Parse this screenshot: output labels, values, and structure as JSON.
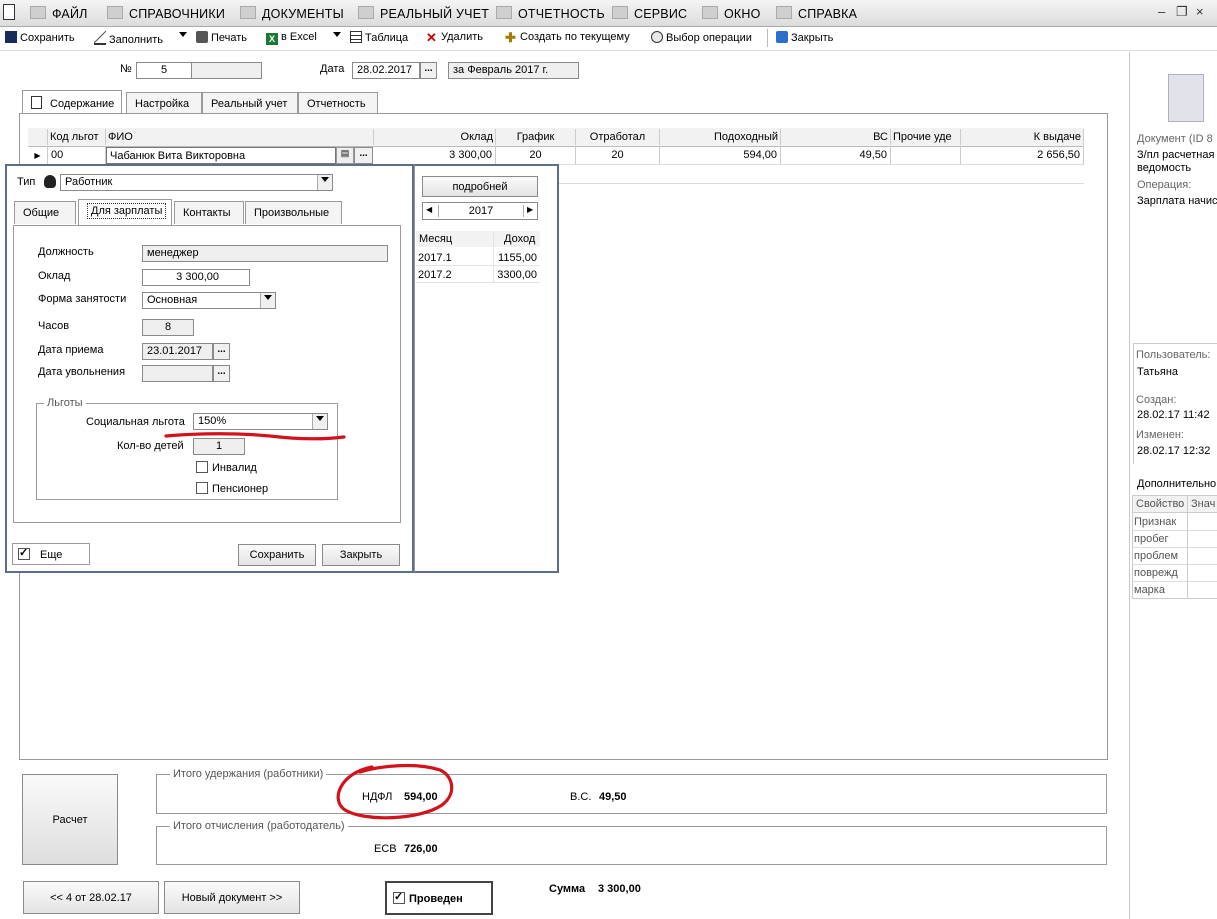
{
  "menu": {
    "items": [
      "ФАЙЛ",
      "СПРАВОЧНИКИ",
      "ДОКУМЕНТЫ",
      "РЕАЛЬНЫЙ УЧЕТ",
      "ОТЧЕТНОСТЬ",
      "СЕРВИС",
      "ОКНО",
      "СПРАВКА"
    ],
    "window_controls": [
      "–",
      "❐",
      "×"
    ]
  },
  "toolbar": {
    "save": "Сохранить",
    "fill": "Заполнить",
    "print": "Печать",
    "excel": "в Excel",
    "table": "Таблица",
    "delete": "Удалить",
    "create_from_current": "Создать по текущему",
    "choose_operation": "Выбор операции",
    "close": "Закрыть"
  },
  "header": {
    "number_label": "№",
    "number_value": "5",
    "date_label": "Дата",
    "date_value": "28.02.2017",
    "period": "за Февраль 2017 г."
  },
  "main_tabs": [
    "Содержание",
    "Настройка",
    "Реальный учет",
    "Отчетность"
  ],
  "grid": {
    "columns": [
      "Код льгот",
      "ФИО",
      "Оклад",
      "График",
      "Отработал",
      "Подоходный",
      "ВС",
      "Прочие уде",
      "К выдаче"
    ],
    "rows": [
      {
        "code": "00",
        "name": "Чабанюк Вита Викторовна",
        "salary": "3 300,00",
        "schedule": "20",
        "worked": "20",
        "income_tax": "594,00",
        "vs": "49,50",
        "other": "",
        "payout": "2 656,50"
      }
    ]
  },
  "popup": {
    "type_label": "Тип",
    "type_value": "Работник",
    "tabs": [
      "Общие",
      "Для зарплаты",
      "Контакты",
      "Произвольные"
    ],
    "position_label": "Должность",
    "position_value": "менеджер",
    "salary_label": "Оклад",
    "salary_value": "3 300,00",
    "employment_label": "Форма занятости",
    "employment_value": "Основная",
    "hours_label": "Часов",
    "hours_value": "8",
    "hire_date_label": "Дата приема",
    "hire_date_value": "23.01.2017",
    "dismissal_label": "Дата увольнения",
    "dismissal_value": "",
    "benefits_legend": "Льготы",
    "social_benefit_label": "Социальная льгота",
    "social_benefit_value": "150%",
    "children_label": "Кол-во детей",
    "children_value": "1",
    "disabled_label": "Инвалид",
    "pensioner_label": "Пенсионер",
    "more_label": "Еще",
    "save_button": "Сохранить",
    "close_button": "Закрыть",
    "details_button": "подробней",
    "year": "2017",
    "income_columns": [
      "Месяц",
      "Доход"
    ],
    "income_rows": [
      {
        "month": "2017.1",
        "income": "1155,00"
      },
      {
        "month": "2017.2",
        "income": "3300,00"
      }
    ]
  },
  "right_panel": {
    "document_label": "Документ  (ID 8",
    "document_name": "З/пл расчетная ведомость",
    "operation_label": "Операция:",
    "operation_value": "Зарплата начис",
    "user_label": "Пользователь:",
    "user_value": "Татьяна",
    "created_label": "Создан:",
    "created_value": "28.02.17  11:42",
    "modified_label": "Изменен:",
    "modified_value": "28.02.17  12:32",
    "additional_label": "Дополнительно",
    "prop_columns": [
      "Свойство",
      "Знач"
    ],
    "props": [
      "Признак",
      "пробег",
      "проблем",
      "поврежд",
      "марка"
    ]
  },
  "footer": {
    "calc_button": "Расчет",
    "withholdings_legend": "Итого удержания (работники)",
    "ndfl_label": "НДФЛ",
    "ndfl_value": "594,00",
    "vs_label": "В.С.",
    "vs_value": "49,50",
    "contributions_legend": "Итого отчисления (работодатель)",
    "esv_label": "ЕСВ",
    "esv_value": "726,00",
    "prev_button": "<< 4 от 28.02.17",
    "new_doc_button": "Новый документ >>",
    "posted_label": "Проведен",
    "sum_label": "Сумма",
    "sum_value": "3 300,00"
  }
}
